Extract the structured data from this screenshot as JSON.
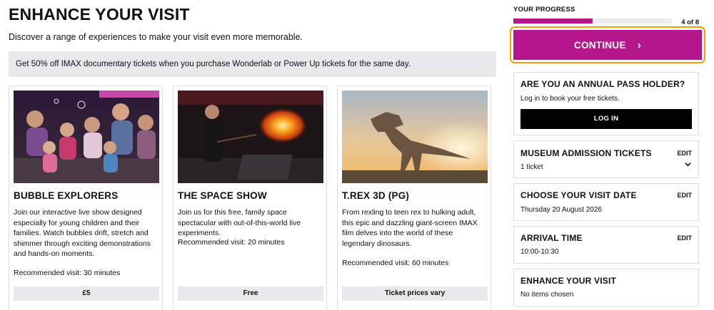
{
  "page": {
    "title": "ENHANCE YOUR VISIT",
    "subtitle": "Discover a range of experiences to make your visit even more memorable.",
    "promo": "Get 50% off IMAX documentary tickets when you purchase Wonderlab or Power Up tickets for the same day."
  },
  "cards": [
    {
      "title": "BUBBLE EXPLORERS",
      "description": "Join our interactive live show designed especially for young children and their families. Watch bubbles drift, stretch and shimmer through exciting demonstrations and hands-on moments.",
      "recommended": "Recommended visit: 30 minutes",
      "price": "£5",
      "image": "children-watching-bubbles-photo"
    },
    {
      "title": "THE SPACE SHOW",
      "description": "Join us for this free, family space spectacular with out-of-this-world live experiments.",
      "recommended": "Recommended visit: 20 minutes",
      "price": "Free",
      "image": "presenter-with-fireball-photo"
    },
    {
      "title": "T.REX 3D (PG)",
      "description": "From rexling to teen rex to hulking adult, this epic and dazzling giant-screen IMAX film delves into the world of these legendary dinosaurs.",
      "recommended": "Recommended visit: 60 minutes",
      "price": "Ticket prices vary",
      "image": "t-rex-at-sunset-photo"
    }
  ],
  "progress": {
    "label": "YOUR PROGRESS",
    "count": "4 of 8",
    "fraction": 0.5
  },
  "continue": {
    "label": "CONTINUE",
    "icon": "chevron-right-icon"
  },
  "annual_pass": {
    "heading": "ARE YOU AN ANNUAL PASS HOLDER?",
    "text": "Log in to book your free tickets.",
    "button": "LOG IN"
  },
  "summary": {
    "edit_label": "EDIT",
    "admission": {
      "heading": "MUSEUM ADMISSION TICKETS",
      "value": "1 ticket"
    },
    "date": {
      "heading": "CHOOSE YOUR VISIT DATE",
      "value": "Thursday 20 August 2026"
    },
    "arrival": {
      "heading": "ARRIVAL TIME",
      "value": "10:00-10:30"
    },
    "enhance": {
      "heading": "ENHANCE YOUR VISIT",
      "value": "No items chosen"
    }
  },
  "colors": {
    "brand": "#b5168c",
    "focus_ring": "#f0a000",
    "grey_panel": "#e9e9ec"
  }
}
